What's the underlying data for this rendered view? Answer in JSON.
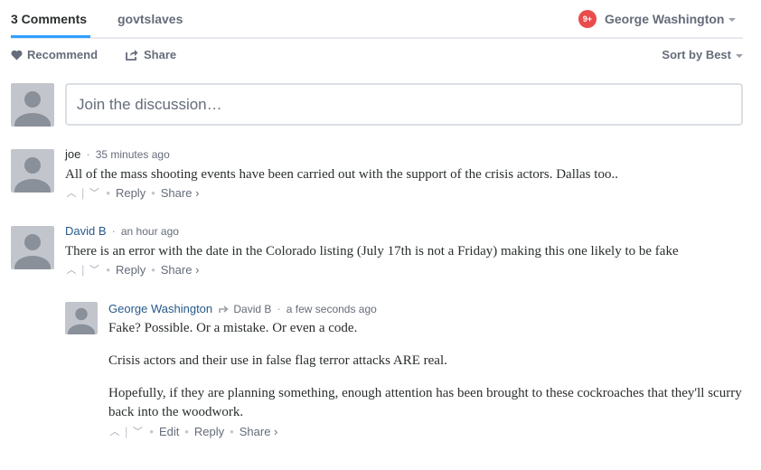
{
  "nav": {
    "comment_count": "3 Comments",
    "community": "govtslaves",
    "notifications": "9+",
    "user": "George Washington"
  },
  "actions": {
    "recommend": "Recommend",
    "share": "Share",
    "sort": "Sort by Best"
  },
  "composer": {
    "placeholder": "Join the discussion…"
  },
  "comments": [
    {
      "author": "joe",
      "time": "35 minutes ago",
      "text": "All of the mass shooting events have been carried out with the support of the crisis actors. Dallas too..",
      "reply": "Reply",
      "share": "Share ›"
    },
    {
      "author": "David B",
      "time": "an hour ago",
      "text": "There is an error with the date in the Colorado listing (July 17th is not a Friday) making this one likely to be fake",
      "reply": "Reply",
      "share": "Share ›"
    },
    {
      "author": "George Washington",
      "reply_to": "David B",
      "time": "a few seconds ago",
      "paragraphs": [
        "Fake? Possible. Or a mistake. Or even a code.",
        "Crisis actors and their use in false flag terror attacks ARE real.",
        "Hopefully, if they are planning something, enough attention has been brought to these cockroaches that they'll scurry back into the woodwork."
      ],
      "edit": "Edit",
      "reply": "Reply",
      "share": "Share ›"
    }
  ],
  "colors": {
    "accent_blue": "#2e9fff",
    "badge_red": "#ea4b4b",
    "author_link": "#28598a",
    "muted": "#656c7a"
  }
}
